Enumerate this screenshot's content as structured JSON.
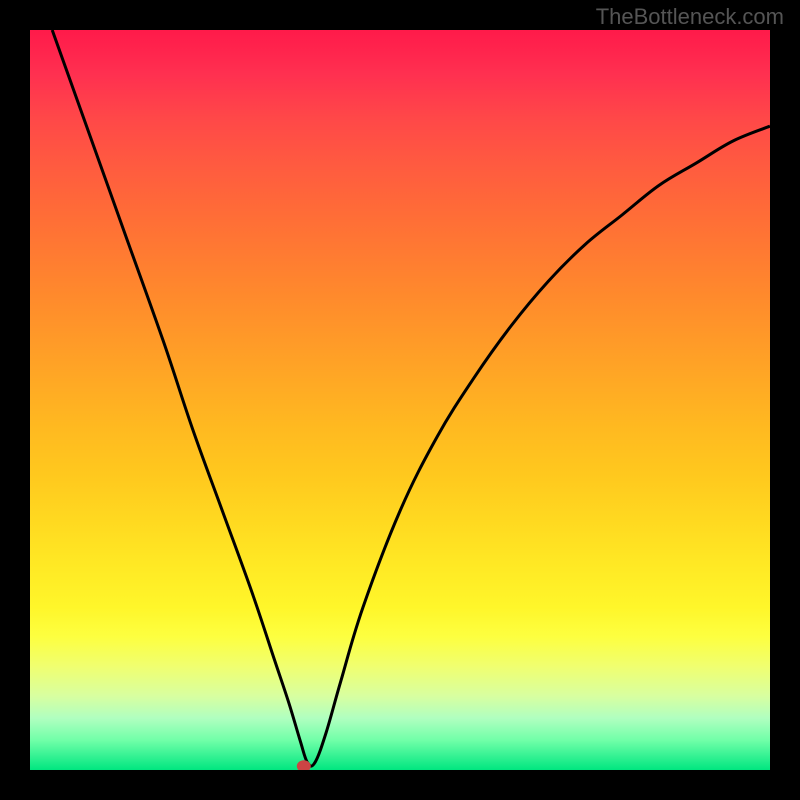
{
  "watermark": "TheBottleneck.com",
  "chart_data": {
    "type": "line",
    "title": "",
    "xlabel": "",
    "ylabel": "",
    "xlim": [
      0,
      100
    ],
    "ylim": [
      0,
      100
    ],
    "series": [
      {
        "name": "curve",
        "x": [
          3,
          8,
          13,
          18,
          22,
          26,
          30,
          33,
          35,
          36.5,
          37.5,
          38.5,
          40,
          42,
          45,
          50,
          55,
          60,
          65,
          70,
          75,
          80,
          85,
          90,
          95,
          100
        ],
        "values": [
          100,
          86,
          72,
          58,
          46,
          35,
          24,
          15,
          9,
          4,
          1,
          1,
          5,
          12,
          22,
          35,
          45,
          53,
          60,
          66,
          71,
          75,
          79,
          82,
          85,
          87
        ]
      }
    ],
    "marker": {
      "x": 37,
      "y": 0.5
    },
    "background_gradient": {
      "type": "vertical",
      "stops": [
        {
          "pos": 0,
          "color": "#ff1a4a"
        },
        {
          "pos": 25,
          "color": "#ff7a32"
        },
        {
          "pos": 50,
          "color": "#ffaa24"
        },
        {
          "pos": 75,
          "color": "#fff62a"
        },
        {
          "pos": 100,
          "color": "#00e680"
        }
      ]
    }
  }
}
